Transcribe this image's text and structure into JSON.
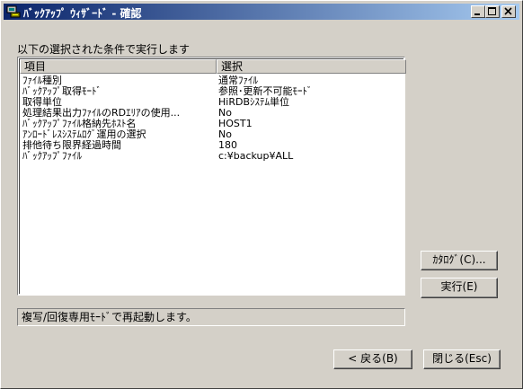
{
  "window": {
    "title": "ﾊﾞｯｸｱｯﾌﾟ ｳｨｻﾞｰﾄﾞ - 確認"
  },
  "caption": "以下の選択された条件で実行します",
  "list": {
    "columns": [
      "項目",
      "選択"
    ],
    "rows": [
      [
        "ﾌｧｲﾙ種別",
        "通常ﾌｧｲﾙ"
      ],
      [
        "ﾊﾞｯｸｱｯﾌﾟ取得ﾓｰﾄﾞ",
        "参照･更新不可能ﾓｰﾄﾞ"
      ],
      [
        "取得単位",
        "HiRDBｼｽﾃﾑ単位"
      ],
      [
        "処理結果出力ﾌｧｲﾙのRDｴﾘｱの使用...",
        "No"
      ],
      [
        "ﾊﾞｯｸｱｯﾌﾟﾌｧｲﾙ格納先ﾎｽﾄ名",
        "HOST1"
      ],
      [
        "ｱﾝﾛｰﾄﾞﾚｽｼｽﾃﾑﾛｸﾞ運用の選択",
        "No"
      ],
      [
        "排他待ち限界経過時間",
        "180"
      ],
      [
        "ﾊﾞｯｸｱｯﾌﾟﾌｧｲﾙ",
        "c:¥backup¥ALL"
      ]
    ]
  },
  "status_text": "複写/回復専用ﾓｰﾄﾞで再起動します。",
  "buttons": {
    "catalog": "ｶﾀﾛｸﾞ(C)...",
    "execute": "実行(E)",
    "back": "< 戻る(B)",
    "close": "閉じる(Esc)"
  },
  "icons": {
    "app": "app-icon",
    "minimize": "minimize-icon",
    "maximize": "maximize-icon",
    "close": "close-icon"
  },
  "colors": {
    "titlebar_start": "#0a246a",
    "titlebar_end": "#a6caf0",
    "face": "#d4d0c8"
  }
}
